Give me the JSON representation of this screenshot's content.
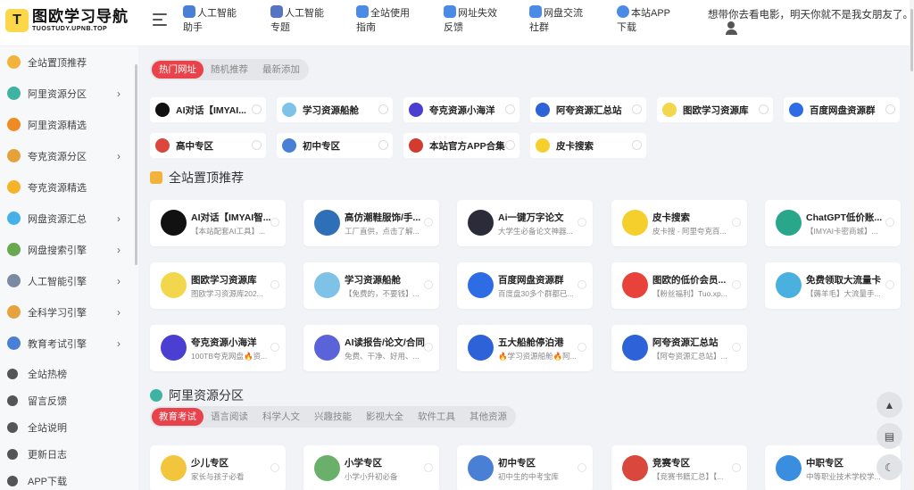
{
  "header": {
    "logo_mark": "T",
    "logo_title": "图欧学习导航",
    "logo_sub": "TUOSTUDY.UPNB.TOP",
    "nav": [
      {
        "label": "人工智能助手",
        "icon": "robot-icon",
        "color": "#4a7fd6"
      },
      {
        "label": "人工智能专题",
        "icon": "robot-icon",
        "color": "#5575c2"
      },
      {
        "label": "全站使用指南",
        "icon": "send-icon",
        "color": "#4a8be8"
      },
      {
        "label": "网址失效反馈",
        "icon": "feedback-icon",
        "color": "#4a8be8"
      },
      {
        "label": "网盘交流社群",
        "icon": "chat-icon",
        "color": "#4a8be8"
      },
      {
        "label": "本站APP下载",
        "icon": "download-icon",
        "color": "#4a8be8"
      }
    ],
    "quote": "想带你去看电影，明天你就不是我女朋友了。"
  },
  "sidebar": {
    "items": [
      {
        "label": "全站置顶推荐",
        "icon": "thumbs-up-icon",
        "color": "#f2b33d",
        "arrow": ""
      },
      {
        "label": "阿里资源分区",
        "icon": "globe-icon",
        "color": "#3fb3a2",
        "arrow": "›"
      },
      {
        "label": "阿里资源精选",
        "icon": "fire-icon",
        "color": "#f08a24",
        "arrow": ""
      },
      {
        "label": "夸克资源分区",
        "icon": "cookie-icon",
        "color": "#e5a23b",
        "arrow": "›"
      },
      {
        "label": "夸克资源精选",
        "icon": "fire-icon",
        "color": "#f5b32a",
        "arrow": ""
      },
      {
        "label": "网盘资源汇总",
        "icon": "diamond-icon",
        "color": "#45b1e8",
        "arrow": "›"
      },
      {
        "label": "网盘搜索引擎",
        "icon": "search-globe-icon",
        "color": "#6aa84f",
        "arrow": "›"
      },
      {
        "label": "人工智能引擎",
        "icon": "robot-icon",
        "color": "#7a8aa3",
        "arrow": "›"
      },
      {
        "label": "全科学习引擎",
        "icon": "warning-icon",
        "color": "#e6a23c",
        "arrow": "›"
      },
      {
        "label": "教育考试引擎",
        "icon": "book-icon",
        "color": "#4a7fd6",
        "arrow": "›"
      }
    ],
    "bottom": [
      {
        "label": "全站热榜",
        "icon": "flame-icon"
      },
      {
        "label": "留言反馈",
        "icon": "pen-icon"
      },
      {
        "label": "全站说明",
        "icon": "shield-icon"
      },
      {
        "label": "更新日志",
        "icon": "doc-icon"
      },
      {
        "label": "APP下载",
        "icon": "dots-icon"
      }
    ]
  },
  "top_tabs": [
    "热门网址",
    "随机推荐",
    "最新添加"
  ],
  "chips": [
    {
      "label": "AI对话【IMYAI...",
      "color": "#111111"
    },
    {
      "label": "学习资源船舱",
      "color": "#7ec2e8"
    },
    {
      "label": "夸克资源小海洋",
      "color": "#4b3fd1"
    },
    {
      "label": "阿夸资源汇总站",
      "color": "#2e62d9"
    },
    {
      "label": "图欧学习资源库",
      "color": "#f2d64b"
    },
    {
      "label": "百度网盘资源群",
      "color": "#2e6ce6"
    },
    {
      "label": "高中专区",
      "color": "#d9473d"
    },
    {
      "label": "初中专区",
      "color": "#4a7fd6"
    },
    {
      "label": "本站官方APP合集",
      "color": "#d33b2f"
    },
    {
      "label": "皮卡搜索",
      "color": "#f5d02d"
    }
  ],
  "section1": {
    "title": "全站置顶推荐",
    "cards": [
      {
        "title": "AI对话【IMYAI智...",
        "desc": "【本站配套AI工具】...",
        "color": "#111111"
      },
      {
        "title": "高仿潮鞋服饰/手...",
        "desc": "工厂直供，点击了解...",
        "color": "#2f6fb8"
      },
      {
        "title": "Ai一键万字论文",
        "desc": "大学生必备论文神器...",
        "color": "#2b2b3a"
      },
      {
        "title": "皮卡搜索",
        "desc": "皮卡搜 - 阿里夸克百...",
        "color": "#f5d02d"
      },
      {
        "title": "ChatGPT低价账...",
        "desc": "【IMYAI卡密商城】...",
        "color": "#2aa68a"
      },
      {
        "title": "图欧学习资源库",
        "desc": "图欧学习资源库202...",
        "color": "#f2d64b"
      },
      {
        "title": "学习资源船舱",
        "desc": "【免费的，不要钱】...",
        "color": "#7ec2e8"
      },
      {
        "title": "百度网盘资源群",
        "desc": "百度盘30多个群都已...",
        "color": "#2e6ce6"
      },
      {
        "title": "图欧的低价会员...",
        "desc": "【粉丝福利】Tuo.xp...",
        "color": "#e8423a"
      },
      {
        "title": "免费领取大流量卡",
        "desc": "【薅羊毛】大流量手...",
        "color": "#4ab0e0"
      },
      {
        "title": "夸克资源小海洋",
        "desc": "100TB夸克网盘🔥资...",
        "color": "#4b3fd1"
      },
      {
        "title": "AI读报告/论文/合同",
        "desc": "免费、干净、好用、...",
        "color": "#5a63d8"
      },
      {
        "title": "五大船舱停泊港",
        "desc": "🔥学习资源船舱🔥阿...",
        "color": "#2e62d9"
      },
      {
        "title": "阿夸资源汇总站",
        "desc": "【阿夸资源汇总站】...",
        "color": "#2e62d9"
      }
    ]
  },
  "section2": {
    "title": "阿里资源分区",
    "tabs": [
      "教育考试",
      "语言阅读",
      "科学人文",
      "兴趣技能",
      "影视大全",
      "软件工具",
      "其他资源"
    ],
    "cards": [
      {
        "title": "少儿专区",
        "desc": "家长与孩子必看",
        "color": "#f2c53d"
      },
      {
        "title": "小学专区",
        "desc": "小学小升初必备",
        "color": "#6ab06a"
      },
      {
        "title": "初中专区",
        "desc": "初中生的中考宝库",
        "color": "#4a7fd6"
      },
      {
        "title": "竞赛专区",
        "desc": "【竞赛书籍汇总】【...",
        "color": "#d9473d"
      },
      {
        "title": "中职专区",
        "desc": "中等职业技术学校学...",
        "color": "#3a8ee0"
      }
    ]
  },
  "fabs": [
    "▲",
    "▤",
    "☾"
  ]
}
